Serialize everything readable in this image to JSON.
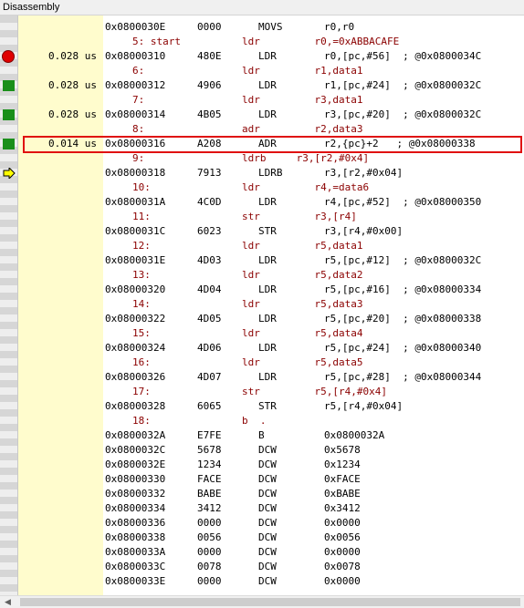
{
  "window": {
    "title": "Disassembly"
  },
  "rows": [
    {
      "type": "instr",
      "marker": "",
      "time": "",
      "addr": "0x0800030E",
      "op": "0000",
      "mn": "MOVS",
      "args": "r0,r0",
      "highlight": true
    },
    {
      "type": "src",
      "marker": "",
      "line": "5: start",
      "code": "ldr         r0,=0xABBACAFE"
    },
    {
      "type": "instr",
      "marker": "breakpoint",
      "time": "0.028 us",
      "addr": "0x08000310",
      "op": "480E",
      "mn": "LDR",
      "args": "r0,[pc,#56]  ; @0x0800034C"
    },
    {
      "type": "src",
      "marker": "",
      "line": "6:",
      "code": "            ldr         r1,data1"
    },
    {
      "type": "instr",
      "marker": "executed",
      "time": "0.028 us",
      "addr": "0x08000312",
      "op": "4906",
      "mn": "LDR",
      "args": "r1,[pc,#24]  ; @0x0800032C"
    },
    {
      "type": "src",
      "marker": "",
      "line": "7:",
      "code": "            ldr         r3,data1"
    },
    {
      "type": "instr",
      "marker": "executed",
      "time": "0.028 us",
      "addr": "0x08000314",
      "op": "4B05",
      "mn": "LDR",
      "args": "r3,[pc,#20]  ; @0x0800032C"
    },
    {
      "type": "src",
      "marker": "",
      "line": "8:",
      "code": "            adr         r2,data3"
    },
    {
      "type": "instr",
      "marker": "executed",
      "time": "0.014 us",
      "addr": "0x08000316",
      "op": "A208",
      "mn": "ADR",
      "args": "r2,{pc}+2   ; @0x08000338"
    },
    {
      "type": "src",
      "marker": "",
      "line": "9:",
      "code": "            ldrb     r3,[r2,#0x4]"
    },
    {
      "type": "instr",
      "marker": "current",
      "time": "",
      "addr": "0x08000318",
      "op": "7913",
      "mn": "LDRB",
      "args": "r3,[r2,#0x04]"
    },
    {
      "type": "src",
      "marker": "",
      "line": "10:",
      "code": "            ldr         r4,=data6"
    },
    {
      "type": "instr",
      "marker": "",
      "time": "",
      "addr": "0x0800031A",
      "op": "4C0D",
      "mn": "LDR",
      "args": "r4,[pc,#52]  ; @0x08000350"
    },
    {
      "type": "src",
      "marker": "",
      "line": "11:",
      "code": "            str         r3,[r4]"
    },
    {
      "type": "instr",
      "marker": "",
      "time": "",
      "addr": "0x0800031C",
      "op": "6023",
      "mn": "STR",
      "args": "r3,[r4,#0x00]"
    },
    {
      "type": "src",
      "marker": "",
      "line": "12:",
      "code": "            ldr         r5,data1"
    },
    {
      "type": "instr",
      "marker": "",
      "time": "",
      "addr": "0x0800031E",
      "op": "4D03",
      "mn": "LDR",
      "args": "r5,[pc,#12]  ; @0x0800032C"
    },
    {
      "type": "src",
      "marker": "",
      "line": "13:",
      "code": "            ldr         r5,data2"
    },
    {
      "type": "instr",
      "marker": "",
      "time": "",
      "addr": "0x08000320",
      "op": "4D04",
      "mn": "LDR",
      "args": "r5,[pc,#16]  ; @0x08000334"
    },
    {
      "type": "src",
      "marker": "",
      "line": "14:",
      "code": "            ldr         r5,data3"
    },
    {
      "type": "instr",
      "marker": "",
      "time": "",
      "addr": "0x08000322",
      "op": "4D05",
      "mn": "LDR",
      "args": "r5,[pc,#20]  ; @0x08000338"
    },
    {
      "type": "src",
      "marker": "",
      "line": "15:",
      "code": "            ldr         r5,data4"
    },
    {
      "type": "instr",
      "marker": "",
      "time": "",
      "addr": "0x08000324",
      "op": "4D06",
      "mn": "LDR",
      "args": "r5,[pc,#24]  ; @0x08000340"
    },
    {
      "type": "src",
      "marker": "",
      "line": "16:",
      "code": "            ldr         r5,data5"
    },
    {
      "type": "instr",
      "marker": "",
      "time": "",
      "addr": "0x08000326",
      "op": "4D07",
      "mn": "LDR",
      "args": "r5,[pc,#28]  ; @0x08000344"
    },
    {
      "type": "src",
      "marker": "",
      "line": "17:",
      "code": "            str         r5,[r4,#0x4]"
    },
    {
      "type": "instr",
      "marker": "",
      "time": "",
      "addr": "0x08000328",
      "op": "6065",
      "mn": "STR",
      "args": "r5,[r4,#0x04]"
    },
    {
      "type": "src",
      "marker": "",
      "line": "18:",
      "code": "            b  ."
    },
    {
      "type": "instr",
      "marker": "",
      "time": "",
      "addr": "0x0800032A",
      "op": "E7FE",
      "mn": "B",
      "args": "0x0800032A"
    },
    {
      "type": "instr",
      "marker": "",
      "time": "",
      "addr": "0x0800032C",
      "op": "5678",
      "mn": "DCW",
      "args": "0x5678"
    },
    {
      "type": "instr",
      "marker": "",
      "time": "",
      "addr": "0x0800032E",
      "op": "1234",
      "mn": "DCW",
      "args": "0x1234"
    },
    {
      "type": "instr",
      "marker": "",
      "time": "",
      "addr": "0x08000330",
      "op": "FACE",
      "mn": "DCW",
      "args": "0xFACE"
    },
    {
      "type": "instr",
      "marker": "",
      "time": "",
      "addr": "0x08000332",
      "op": "BABE",
      "mn": "DCW",
      "args": "0xBABE"
    },
    {
      "type": "instr",
      "marker": "",
      "time": "",
      "addr": "0x08000334",
      "op": "3412",
      "mn": "DCW",
      "args": "0x3412"
    },
    {
      "type": "instr",
      "marker": "",
      "time": "",
      "addr": "0x08000336",
      "op": "0000",
      "mn": "DCW",
      "args": "0x0000"
    },
    {
      "type": "instr",
      "marker": "",
      "time": "",
      "addr": "0x08000338",
      "op": "0056",
      "mn": "DCW",
      "args": "0x0056"
    },
    {
      "type": "instr",
      "marker": "",
      "time": "",
      "addr": "0x0800033A",
      "op": "0000",
      "mn": "DCW",
      "args": "0x0000"
    },
    {
      "type": "instr",
      "marker": "",
      "time": "",
      "addr": "0x0800033C",
      "op": "0078",
      "mn": "DCW",
      "args": "0x0078"
    },
    {
      "type": "instr",
      "marker": "",
      "time": "",
      "addr": "0x0800033E",
      "op": "0000",
      "mn": "DCW",
      "args": "0x0000"
    }
  ],
  "colors": {
    "time_column": "#fffccd",
    "current_line": "#ffff00",
    "source_text": "#8b0000",
    "breakpoint": "#e00000",
    "executed": "#1a8f1a",
    "outline": "#e01010"
  },
  "icons": {
    "breakpoint": "breakpoint-icon",
    "executed": "executed-marker-icon",
    "current": "current-instruction-arrow-icon"
  }
}
